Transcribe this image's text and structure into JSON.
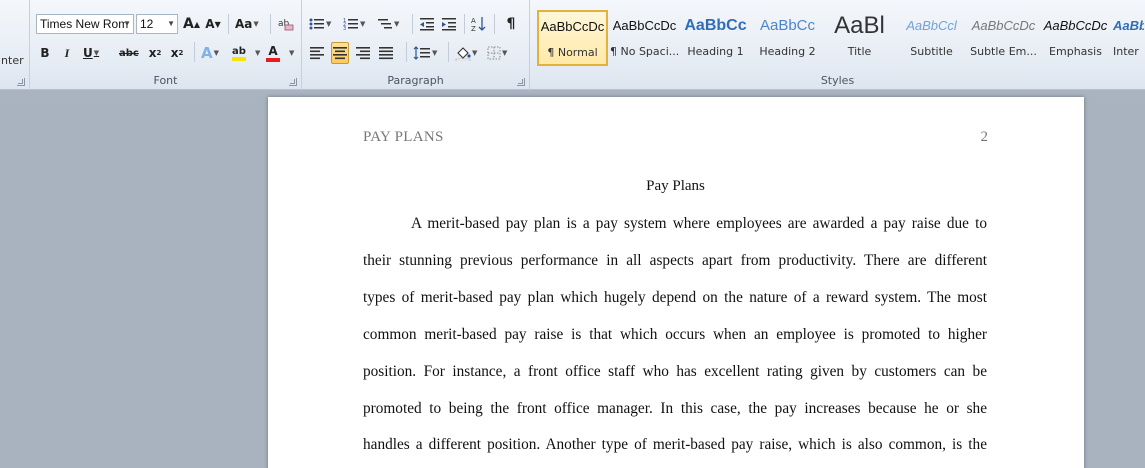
{
  "ribbon": {
    "clipboard": {
      "partial_label": "inter"
    },
    "font": {
      "group_label": "Font",
      "font_name": "Times New Rom",
      "font_size": "12",
      "grow_label": "A",
      "shrink_label": "A",
      "change_case_label": "Aa",
      "bold_label": "B",
      "italic_label": "I",
      "underline_label": "U",
      "strike_label": "abc",
      "subscript_label": "x",
      "superscript_label": "x",
      "effects_label": "A",
      "highlight_label": "ab",
      "font_color_label": "A",
      "highlight_color": "#f5e400",
      "font_color": "#e81c1c"
    },
    "paragraph": {
      "group_label": "Paragraph",
      "pilcrow": "¶"
    },
    "styles": {
      "group_label": "Styles",
      "items": [
        {
          "sample": "AaBbCcDc",
          "name": "¶ Normal",
          "selected": true
        },
        {
          "sample": "AaBbCcDc",
          "name": "¶ No Spaci..."
        },
        {
          "sample": "AaBbCc",
          "name": "Heading 1"
        },
        {
          "sample": "AaBbCc",
          "name": "Heading 2"
        },
        {
          "sample": "AaBl",
          "name": "Title"
        },
        {
          "sample": "AaBbCcl",
          "name": "Subtitle"
        },
        {
          "sample": "AaBbCcDc",
          "name": "Subtle Em..."
        },
        {
          "sample": "AaBbCcDc",
          "name": "Emphasis"
        },
        {
          "sample": "AaBbCcDc",
          "name": "Inter"
        }
      ]
    }
  },
  "document": {
    "header_text": "PAY PLANS",
    "page_number": "2",
    "title": "Pay Plans",
    "lines": [
      "A merit-based pay plan is a pay system where employees are awarded a pay raise due to",
      "their stunning previous performance in all aspects apart from productivity. There are different",
      "types of merit-based pay plan which hugely depend on the nature of a reward system. The most",
      "common merit-based pay raise is that which occurs when an employee is promoted to higher",
      "position.  For instance, a front office staff who has excellent rating given by customers can be",
      "promoted to being the front office manager. In this case, the pay increases because he or she",
      "handles a different position. Another type of merit-based pay raise, which is also common, is the"
    ]
  }
}
